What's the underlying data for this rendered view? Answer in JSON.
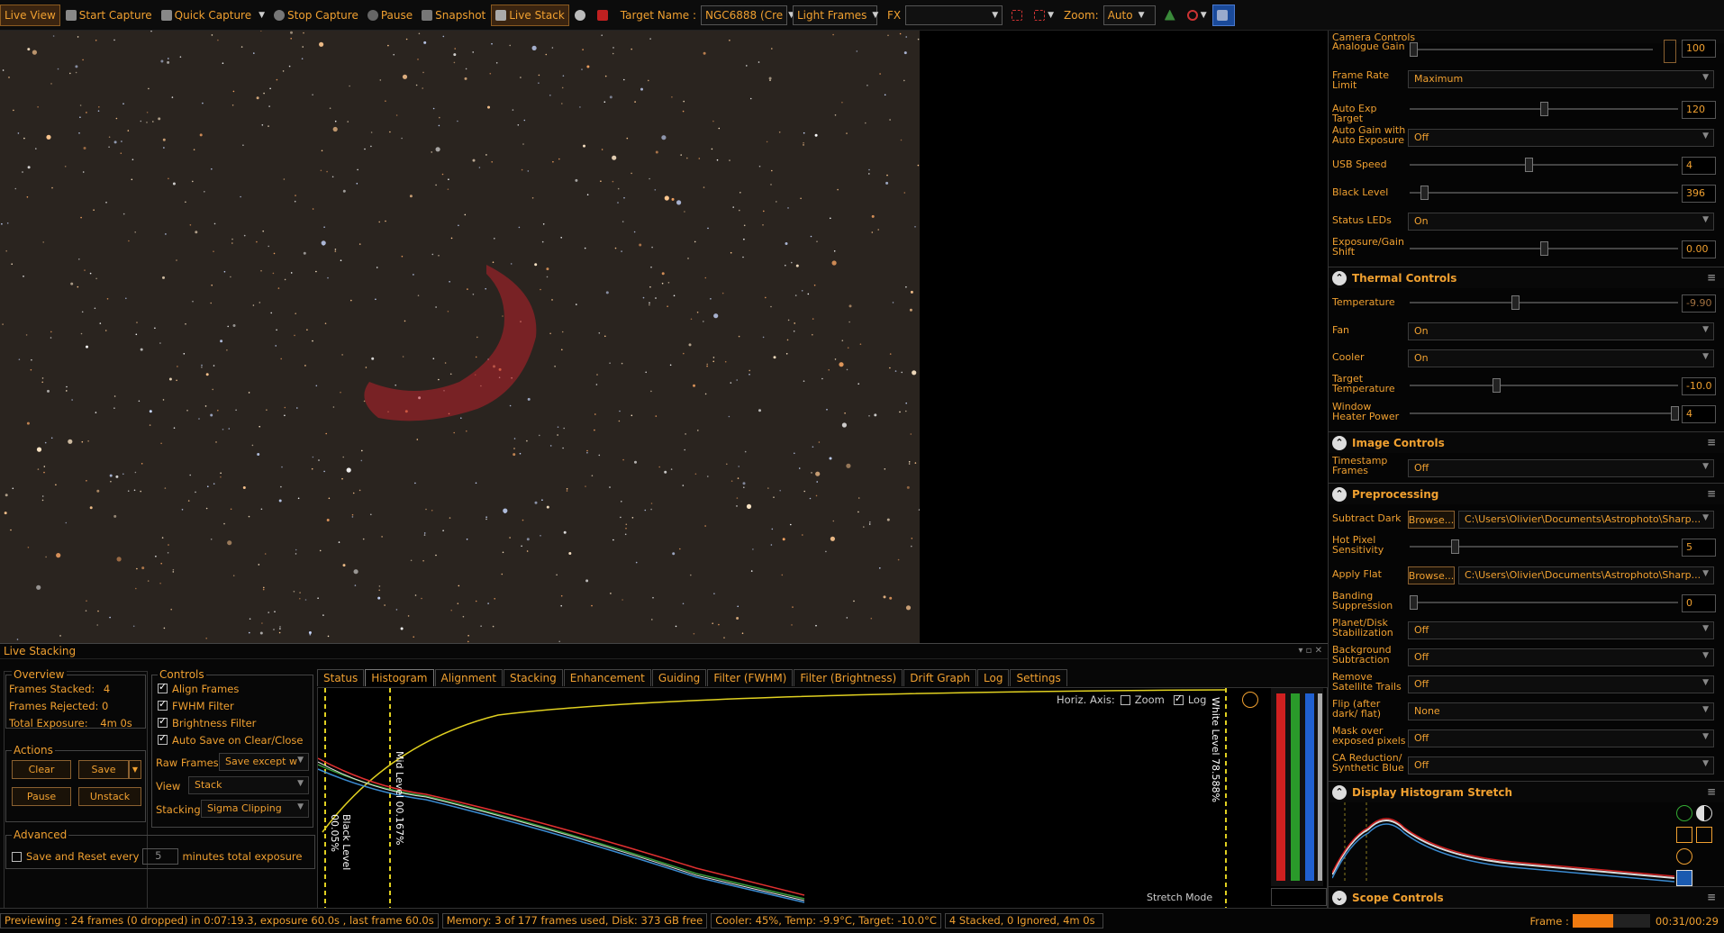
{
  "toolbar": {
    "live_view": "Live View",
    "start_capture": "Start Capture",
    "quick_capture": "Quick Capture",
    "stop_capture": "Stop Capture",
    "pause": "Pause",
    "snapshot": "Snapshot",
    "live_stack": "Live Stack",
    "target_name_label": "Target Name :",
    "target_name_value": "NGC6888 (Cre",
    "frame_type": "Light Frames",
    "fx_label": "FX",
    "fx_value": "",
    "zoom_label": "Zoom:",
    "zoom_value": "Auto"
  },
  "right_panel": {
    "camera_controls": {
      "title": "Camera Controls",
      "analogue_gain": {
        "label": "Analogue Gain",
        "value": "100"
      },
      "frame_rate_limit": {
        "label": "Frame Rate Limit",
        "value": "Maximum"
      },
      "auto_exp_target": {
        "label": "Auto Exp Target",
        "value": "120"
      },
      "auto_gain": {
        "label": "Auto Gain with Auto Exposure",
        "value": "Off"
      },
      "usb_speed": {
        "label": "USB Speed",
        "value": "4"
      },
      "black_level": {
        "label": "Black Level",
        "value": "396"
      },
      "status_leds": {
        "label": "Status LEDs",
        "value": "On"
      },
      "exposure_gain_shift": {
        "label": "Exposure/Gain Shift",
        "value": "0.00"
      }
    },
    "thermal_controls": {
      "title": "Thermal Controls",
      "temperature": {
        "label": "Temperature",
        "value": "-9.90"
      },
      "fan": {
        "label": "Fan",
        "value": "On"
      },
      "cooler": {
        "label": "Cooler",
        "value": "On"
      },
      "target_temperature": {
        "label": "Target Temperature",
        "value": "-10.0"
      },
      "window_heater": {
        "label": "Window Heater Power",
        "value": "4"
      }
    },
    "image_controls": {
      "title": "Image Controls",
      "timestamp_frames": {
        "label": "Timestamp Frames",
        "value": "Off"
      }
    },
    "preprocessing": {
      "title": "Preprocessing",
      "subtract_dark": {
        "label": "Subtract Dark",
        "button": "Browse...",
        "path": "C:\\Users\\Olivier\\Documents\\Astrophoto\\Sharp..."
      },
      "hot_pixel": {
        "label": "Hot Pixel Sensitivity",
        "value": "5"
      },
      "apply_flat": {
        "label": "Apply Flat",
        "button": "Browse...",
        "path": "C:\\Users\\Olivier\\Documents\\Astrophoto\\Sharp..."
      },
      "banding": {
        "label": "Banding Suppression",
        "value": "0"
      },
      "planet_disk": {
        "label": "Planet/Disk Stabilization",
        "value": "Off"
      },
      "background_subtraction": {
        "label": "Background Subtraction",
        "value": "Off"
      },
      "remove_satellite": {
        "label": "Remove Satellite Trails",
        "value": "Off"
      },
      "flip": {
        "label": "Flip (after dark/ flat)",
        "value": "None"
      },
      "mask_over": {
        "label": "Mask over exposed pixels",
        "value": "Off"
      },
      "ca_reduction": {
        "label": "CA Reduction/ Synthetic Blue",
        "value": "Off"
      }
    },
    "display_histogram": {
      "title": "Display Histogram Stretch"
    },
    "scope_controls": {
      "title": "Scope Controls"
    }
  },
  "live_stacking": {
    "title": "Live Stacking",
    "overview": {
      "title": "Overview",
      "frames_stacked_label": "Frames Stacked:",
      "frames_stacked": "4",
      "frames_rejected_label": "Frames Rejected:",
      "frames_rejected": "0",
      "total_exposure_label": "Total Exposure:",
      "total_exposure": "4m 0s"
    },
    "actions": {
      "title": "Actions",
      "clear": "Clear",
      "save": "Save",
      "pause": "Pause",
      "unstack": "Unstack"
    },
    "advanced": {
      "title": "Advanced",
      "save_reset_label": "Save and Reset every",
      "minutes": "5",
      "minutes_suffix": "minutes total exposure"
    },
    "controls": {
      "title": "Controls",
      "align_frames": "Align Frames",
      "fwhm_filter": "FWHM Filter",
      "brightness_filter": "Brightness Filter",
      "auto_save": "Auto Save on Clear/Close",
      "raw_frames_label": "Raw Frames",
      "raw_frames_value": "Save except w",
      "view_label": "View",
      "view_value": "Stack",
      "stacking_label": "Stacking",
      "stacking_value": "Sigma Clipping"
    },
    "tabs": [
      "Status",
      "Histogram",
      "Alignment",
      "Stacking",
      "Enhancement",
      "Guiding",
      "Filter (FWHM)",
      "Filter (Brightness)",
      "Drift Graph",
      "Log",
      "Settings"
    ],
    "histogram": {
      "horiz_axis": "Horiz. Axis:",
      "zoom": "Zoom",
      "log": "Log",
      "black_level": "Black Level 00.05%",
      "mid_level": "Mid Level 00.167%",
      "white_level": "White Level 78.588%",
      "stretch_mode": "Stretch Mode"
    }
  },
  "status_bar": {
    "previewing": "Previewing : 24 frames (0 dropped) in 0:07:19.3, exposure 60.0s , last frame 60.0s",
    "memory": "Memory: 3 of 177 frames used, Disk: 373 GB free",
    "cooler": "Cooler: 45%, Temp: -9.9°C, Target: -10.0°C",
    "stacked": "4 Stacked, 0 Ignored, 4m 0s",
    "frame_label": "Frame :",
    "frame_time": "00:31/00:29"
  }
}
